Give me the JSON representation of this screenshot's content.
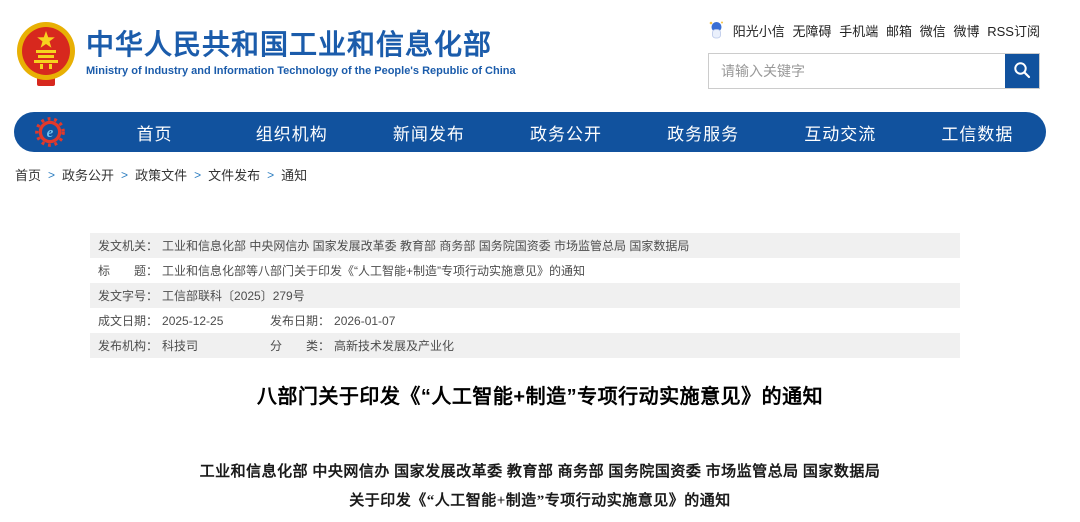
{
  "header": {
    "org_name_cn": "中华人民共和国工业和信息化部",
    "org_name_en": "Ministry of Industry and Information Technology of the People's Republic of China",
    "quick_links": [
      "阳光小信",
      "无障碍",
      "手机端",
      "邮箱",
      "微信",
      "微博",
      "RSS订阅"
    ],
    "search": {
      "placeholder": "请输入关键字"
    }
  },
  "nav": {
    "items": [
      "首页",
      "组织机构",
      "新闻发布",
      "政务公开",
      "政务服务",
      "互动交流",
      "工信数据"
    ]
  },
  "breadcrumb": {
    "separator": ">",
    "items": [
      "首页",
      "政务公开",
      "政策文件",
      "文件发布",
      "通知"
    ]
  },
  "doc_meta": {
    "rows": [
      {
        "label": "发文机关：",
        "value": "工业和信息化部 中央网信办 国家发展改革委 教育部 商务部 国务院国资委 市场监管总局 国家数据局"
      },
      {
        "label": "标　　题：",
        "value": "工业和信息化部等八部门关于印发《“人工智能+制造”专项行动实施意见》的通知"
      },
      {
        "label": "发文字号：",
        "value": "工信部联科〔2025〕279号"
      },
      {
        "label": "成文日期：",
        "value": "2025-12-25",
        "label2": "发布日期：",
        "value2": "2026-01-07"
      },
      {
        "label": "发布机构：",
        "value": "科技司",
        "label2": "分　　类：",
        "value2": "高新技术发展及产业化"
      }
    ]
  },
  "article": {
    "title": "八部门关于印发《“人工智能+制造”专项行动实施意见》的通知",
    "body_lines": [
      "工业和信息化部 中央网信办 国家发展改革委 教育部 商务部 国务院国资委 市场监管总局 国家数据局",
      "关于印发《“人工智能+制造”专项行动实施意见》的通知"
    ]
  },
  "colors": {
    "nav_blue": "#11529e",
    "title_blue": "#1b5cab",
    "emblem_red": "#d7281e",
    "emblem_gold": "#e8b004",
    "row_alt_gray": "#f0f0f0"
  }
}
